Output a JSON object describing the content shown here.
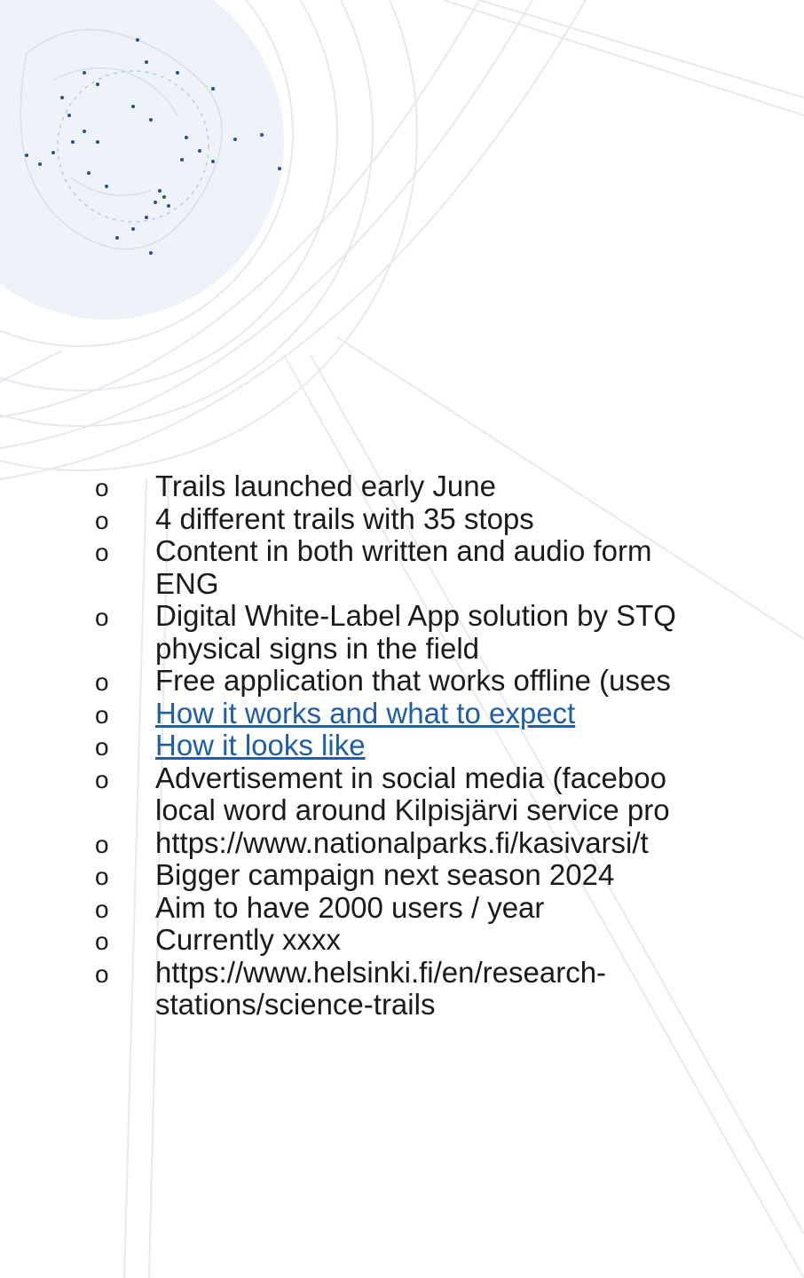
{
  "accent_link_color": "#1f5ea8",
  "background_color": "#ffffff",
  "bullet_marker": "o",
  "bullets": [
    {
      "text": "Trails launched early June",
      "link": false
    },
    {
      "text": "4 different trails with 35 stops",
      "link": false
    },
    {
      "text": "Content in both written and audio form",
      "cont": "ENG",
      "link": false
    },
    {
      "text": "Digital White-Label App solution by STQ",
      "cont": "physical signs in the field",
      "link": false
    },
    {
      "text": "Free application that works offline (uses",
      "link": false
    },
    {
      "text": "How it works and what to expect",
      "link": true
    },
    {
      "text": "How it looks like",
      "link": true
    },
    {
      "text": "Advertisement in social media (faceboo",
      "cont": "local word around Kilpisjärvi service pro",
      "link": false
    },
    {
      "text": "https://www.nationalparks.fi/kasivarsi/t",
      "link": false
    },
    {
      "text": "Bigger campaign next season 2024",
      "link": false
    },
    {
      "text": "Aim to have 2000 users / year",
      "link": false
    },
    {
      "text": "Currently xxxx",
      "link": false
    },
    {
      "text": "https://www.helsinki.fi/en/research-",
      "cont": "stations/science-trails",
      "link": false
    }
  ]
}
